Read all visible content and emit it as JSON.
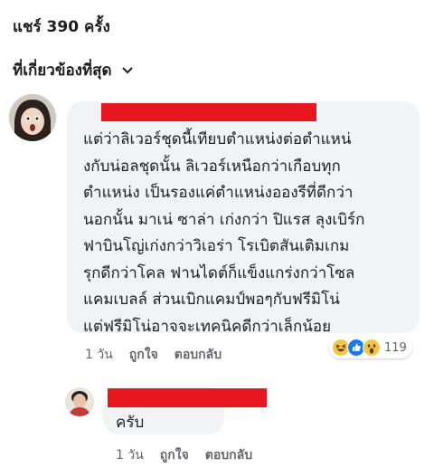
{
  "header": {
    "share_count": "แชร์ 390 ครั้ง",
    "sort_label": "ที่เกี่ยวข้องที่สุด"
  },
  "comment": {
    "lines": [
      "แต่ว่าลิเวอร์ชุดนี้เทียบตำแหน่งต่อตำแหน่",
      "งกับน่อลชุดนั้น ลิเวอร์เหนือกว่าเกือบทุก",
      "ตำแหน่ง เป็นรองแค่ตำแหน่งอองรีที่ดีกว่า",
      "นอกนั้น มาเน่ ซาล่า เก่งกว่า ปิแรส ลุงเบิร์ก",
      "ฟาบินโญ่เก่งกว่าวิเอร่า โรเบิตสันเติมเกม",
      "รุกดีกว่าโคล ฟานไดต์ก็แข็งแกร่งกว่าโซล",
      "แคมเบลล์ ส่วนเบิกแคมป์พอๆกับฟรีมิโน่",
      "แต่ฟรีมิโน่อาจจะเทคนิคดีกว่าเล็กน้อย"
    ],
    "time": "1 วัน",
    "like_label": "ถูกใจ",
    "reply_label": "ตอบกลับ",
    "reaction_count": "119",
    "reactions": [
      "haha",
      "like",
      "wow"
    ]
  },
  "reply": {
    "text": "ครับ",
    "time": "1 วัน",
    "like_label": "ถูกใจ",
    "reply_label": "ตอบกลับ"
  },
  "colors": {
    "redaction": "#e8161f",
    "bubble": "#f2f3f5",
    "like_blue": "#1877f2",
    "reaction_yellow": "#f7c544"
  }
}
